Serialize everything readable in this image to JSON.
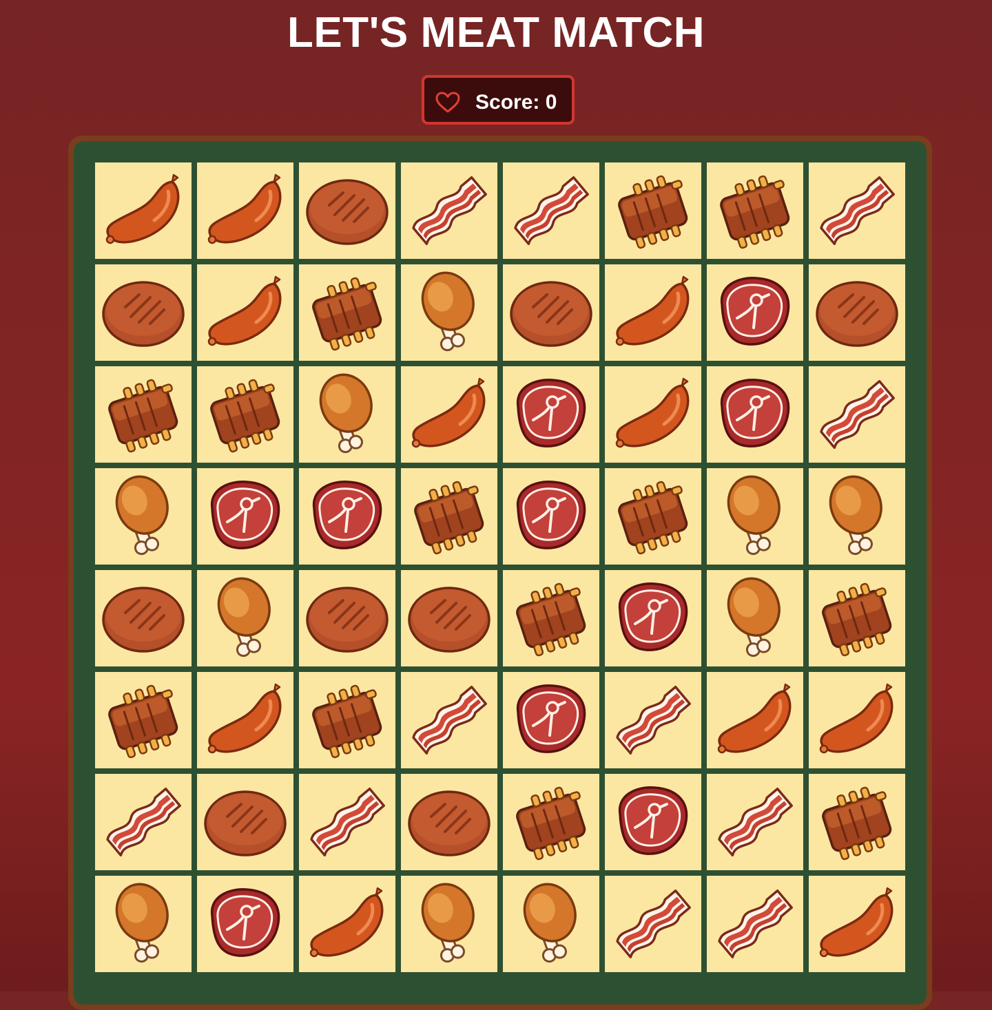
{
  "header": {
    "title": "LET'S MEAT MATCH"
  },
  "score": {
    "label": "Score: 0",
    "value": 0,
    "icon": "heart-outline-icon"
  },
  "colors": {
    "background": "#7a2424",
    "board_border": "#7a3d1e",
    "board": "#2e5032",
    "tile": "#fbe7a1",
    "score_border": "#d0372f"
  },
  "board": {
    "rows": 8,
    "cols": 8,
    "tiles": [
      [
        "sausage",
        "sausage",
        "patty",
        "bacon",
        "bacon",
        "ribs",
        "ribs",
        "bacon"
      ],
      [
        "patty",
        "sausage",
        "ribs",
        "drumstick",
        "patty",
        "sausage",
        "steak",
        "patty"
      ],
      [
        "ribs",
        "ribs",
        "drumstick",
        "sausage",
        "steak",
        "sausage",
        "steak",
        "bacon"
      ],
      [
        "drumstick",
        "steak",
        "steak",
        "ribs",
        "steak",
        "ribs",
        "drumstick",
        "drumstick"
      ],
      [
        "patty",
        "drumstick",
        "patty",
        "patty",
        "ribs",
        "steak",
        "drumstick",
        "ribs"
      ],
      [
        "ribs",
        "sausage",
        "ribs",
        "bacon",
        "steak",
        "bacon",
        "sausage",
        "sausage"
      ],
      [
        "bacon",
        "patty",
        "bacon",
        "patty",
        "ribs",
        "steak",
        "bacon",
        "ribs"
      ],
      [
        "drumstick",
        "steak",
        "sausage",
        "drumstick",
        "drumstick",
        "bacon",
        "bacon",
        "sausage"
      ]
    ]
  }
}
